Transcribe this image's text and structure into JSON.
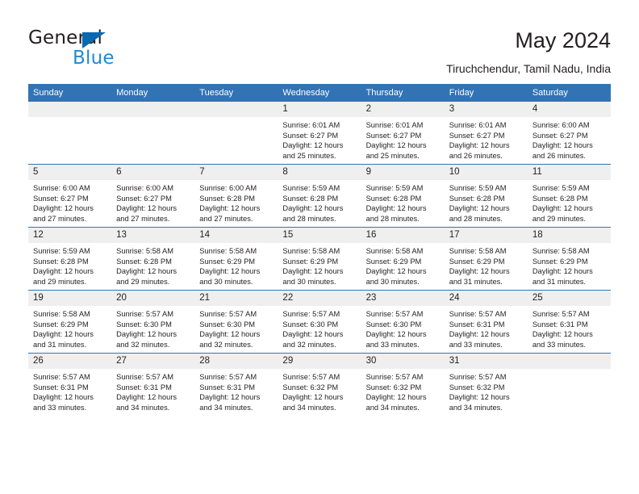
{
  "brand": {
    "name_part1": "General",
    "name_part2": "Blue",
    "triangle_icon": "triangle-icon",
    "accent_color": "#1e8ad6"
  },
  "header": {
    "title": "May 2024",
    "subtitle": "Tiruchchendur, Tamil Nadu, India"
  },
  "theme": {
    "header_blue": "#3273b4",
    "daynum_band": "#efefef",
    "text": "#231f20"
  },
  "calendar": {
    "weekday_headers": [
      "Sunday",
      "Monday",
      "Tuesday",
      "Wednesday",
      "Thursday",
      "Friday",
      "Saturday"
    ],
    "weeks": [
      [
        {
          "day": "",
          "empty": true,
          "sunrise": "",
          "sunset": "",
          "daylight1": "",
          "daylight2": ""
        },
        {
          "day": "",
          "empty": true,
          "sunrise": "",
          "sunset": "",
          "daylight1": "",
          "daylight2": ""
        },
        {
          "day": "",
          "empty": true,
          "sunrise": "",
          "sunset": "",
          "daylight1": "",
          "daylight2": ""
        },
        {
          "day": "1",
          "empty": false,
          "sunrise": "Sunrise: 6:01 AM",
          "sunset": "Sunset: 6:27 PM",
          "daylight1": "Daylight: 12 hours",
          "daylight2": "and 25 minutes."
        },
        {
          "day": "2",
          "empty": false,
          "sunrise": "Sunrise: 6:01 AM",
          "sunset": "Sunset: 6:27 PM",
          "daylight1": "Daylight: 12 hours",
          "daylight2": "and 25 minutes."
        },
        {
          "day": "3",
          "empty": false,
          "sunrise": "Sunrise: 6:01 AM",
          "sunset": "Sunset: 6:27 PM",
          "daylight1": "Daylight: 12 hours",
          "daylight2": "and 26 minutes."
        },
        {
          "day": "4",
          "empty": false,
          "sunrise": "Sunrise: 6:00 AM",
          "sunset": "Sunset: 6:27 PM",
          "daylight1": "Daylight: 12 hours",
          "daylight2": "and 26 minutes."
        }
      ],
      [
        {
          "day": "5",
          "empty": false,
          "sunrise": "Sunrise: 6:00 AM",
          "sunset": "Sunset: 6:27 PM",
          "daylight1": "Daylight: 12 hours",
          "daylight2": "and 27 minutes."
        },
        {
          "day": "6",
          "empty": false,
          "sunrise": "Sunrise: 6:00 AM",
          "sunset": "Sunset: 6:27 PM",
          "daylight1": "Daylight: 12 hours",
          "daylight2": "and 27 minutes."
        },
        {
          "day": "7",
          "empty": false,
          "sunrise": "Sunrise: 6:00 AM",
          "sunset": "Sunset: 6:28 PM",
          "daylight1": "Daylight: 12 hours",
          "daylight2": "and 27 minutes."
        },
        {
          "day": "8",
          "empty": false,
          "sunrise": "Sunrise: 5:59 AM",
          "sunset": "Sunset: 6:28 PM",
          "daylight1": "Daylight: 12 hours",
          "daylight2": "and 28 minutes."
        },
        {
          "day": "9",
          "empty": false,
          "sunrise": "Sunrise: 5:59 AM",
          "sunset": "Sunset: 6:28 PM",
          "daylight1": "Daylight: 12 hours",
          "daylight2": "and 28 minutes."
        },
        {
          "day": "10",
          "empty": false,
          "sunrise": "Sunrise: 5:59 AM",
          "sunset": "Sunset: 6:28 PM",
          "daylight1": "Daylight: 12 hours",
          "daylight2": "and 28 minutes."
        },
        {
          "day": "11",
          "empty": false,
          "sunrise": "Sunrise: 5:59 AM",
          "sunset": "Sunset: 6:28 PM",
          "daylight1": "Daylight: 12 hours",
          "daylight2": "and 29 minutes."
        }
      ],
      [
        {
          "day": "12",
          "empty": false,
          "sunrise": "Sunrise: 5:59 AM",
          "sunset": "Sunset: 6:28 PM",
          "daylight1": "Daylight: 12 hours",
          "daylight2": "and 29 minutes."
        },
        {
          "day": "13",
          "empty": false,
          "sunrise": "Sunrise: 5:58 AM",
          "sunset": "Sunset: 6:28 PM",
          "daylight1": "Daylight: 12 hours",
          "daylight2": "and 29 minutes."
        },
        {
          "day": "14",
          "empty": false,
          "sunrise": "Sunrise: 5:58 AM",
          "sunset": "Sunset: 6:29 PM",
          "daylight1": "Daylight: 12 hours",
          "daylight2": "and 30 minutes."
        },
        {
          "day": "15",
          "empty": false,
          "sunrise": "Sunrise: 5:58 AM",
          "sunset": "Sunset: 6:29 PM",
          "daylight1": "Daylight: 12 hours",
          "daylight2": "and 30 minutes."
        },
        {
          "day": "16",
          "empty": false,
          "sunrise": "Sunrise: 5:58 AM",
          "sunset": "Sunset: 6:29 PM",
          "daylight1": "Daylight: 12 hours",
          "daylight2": "and 30 minutes."
        },
        {
          "day": "17",
          "empty": false,
          "sunrise": "Sunrise: 5:58 AM",
          "sunset": "Sunset: 6:29 PM",
          "daylight1": "Daylight: 12 hours",
          "daylight2": "and 31 minutes."
        },
        {
          "day": "18",
          "empty": false,
          "sunrise": "Sunrise: 5:58 AM",
          "sunset": "Sunset: 6:29 PM",
          "daylight1": "Daylight: 12 hours",
          "daylight2": "and 31 minutes."
        }
      ],
      [
        {
          "day": "19",
          "empty": false,
          "sunrise": "Sunrise: 5:58 AM",
          "sunset": "Sunset: 6:29 PM",
          "daylight1": "Daylight: 12 hours",
          "daylight2": "and 31 minutes."
        },
        {
          "day": "20",
          "empty": false,
          "sunrise": "Sunrise: 5:57 AM",
          "sunset": "Sunset: 6:30 PM",
          "daylight1": "Daylight: 12 hours",
          "daylight2": "and 32 minutes."
        },
        {
          "day": "21",
          "empty": false,
          "sunrise": "Sunrise: 5:57 AM",
          "sunset": "Sunset: 6:30 PM",
          "daylight1": "Daylight: 12 hours",
          "daylight2": "and 32 minutes."
        },
        {
          "day": "22",
          "empty": false,
          "sunrise": "Sunrise: 5:57 AM",
          "sunset": "Sunset: 6:30 PM",
          "daylight1": "Daylight: 12 hours",
          "daylight2": "and 32 minutes."
        },
        {
          "day": "23",
          "empty": false,
          "sunrise": "Sunrise: 5:57 AM",
          "sunset": "Sunset: 6:30 PM",
          "daylight1": "Daylight: 12 hours",
          "daylight2": "and 33 minutes."
        },
        {
          "day": "24",
          "empty": false,
          "sunrise": "Sunrise: 5:57 AM",
          "sunset": "Sunset: 6:31 PM",
          "daylight1": "Daylight: 12 hours",
          "daylight2": "and 33 minutes."
        },
        {
          "day": "25",
          "empty": false,
          "sunrise": "Sunrise: 5:57 AM",
          "sunset": "Sunset: 6:31 PM",
          "daylight1": "Daylight: 12 hours",
          "daylight2": "and 33 minutes."
        }
      ],
      [
        {
          "day": "26",
          "empty": false,
          "sunrise": "Sunrise: 5:57 AM",
          "sunset": "Sunset: 6:31 PM",
          "daylight1": "Daylight: 12 hours",
          "daylight2": "and 33 minutes."
        },
        {
          "day": "27",
          "empty": false,
          "sunrise": "Sunrise: 5:57 AM",
          "sunset": "Sunset: 6:31 PM",
          "daylight1": "Daylight: 12 hours",
          "daylight2": "and 34 minutes."
        },
        {
          "day": "28",
          "empty": false,
          "sunrise": "Sunrise: 5:57 AM",
          "sunset": "Sunset: 6:31 PM",
          "daylight1": "Daylight: 12 hours",
          "daylight2": "and 34 minutes."
        },
        {
          "day": "29",
          "empty": false,
          "sunrise": "Sunrise: 5:57 AM",
          "sunset": "Sunset: 6:32 PM",
          "daylight1": "Daylight: 12 hours",
          "daylight2": "and 34 minutes."
        },
        {
          "day": "30",
          "empty": false,
          "sunrise": "Sunrise: 5:57 AM",
          "sunset": "Sunset: 6:32 PM",
          "daylight1": "Daylight: 12 hours",
          "daylight2": "and 34 minutes."
        },
        {
          "day": "31",
          "empty": false,
          "sunrise": "Sunrise: 5:57 AM",
          "sunset": "Sunset: 6:32 PM",
          "daylight1": "Daylight: 12 hours",
          "daylight2": "and 34 minutes."
        },
        {
          "day": "",
          "empty": true,
          "sunrise": "",
          "sunset": "",
          "daylight1": "",
          "daylight2": ""
        }
      ]
    ]
  }
}
